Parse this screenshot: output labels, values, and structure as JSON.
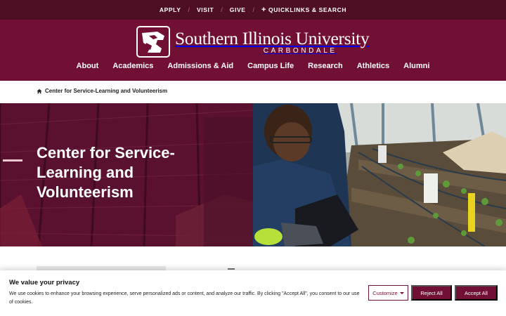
{
  "utility_nav": {
    "items": [
      "APPLY",
      "VISIT",
      "GIVE"
    ],
    "quicklinks_label": "QUICKLINKS & SEARCH"
  },
  "logo": {
    "name": "Southern Illinois University",
    "campus": "CARBONDALE"
  },
  "main_nav": [
    "About",
    "Academics",
    "Admissions & Aid",
    "Campus Life",
    "Research",
    "Athletics",
    "Alumni"
  ],
  "breadcrumb": {
    "icon": "home-icon",
    "current": "Center for Service-Learning and Volunteerism"
  },
  "hero": {
    "title": "Center for Service-Learning and Volunteerism",
    "image_description_icon": "garden-photo"
  },
  "cookie_banner": {
    "title": "We value your privacy",
    "text": "We use cookies to enhance your browsing experience, serve personalized ads or content, and analyze our traffic. By clicking \"Accept All\", you consent to our use of cookies.",
    "customize_label": "Customize",
    "reject_label": "Reject All",
    "accept_label": "Accept All"
  },
  "colors": {
    "maroon": "#720f35",
    "dark_maroon": "#4e0e24"
  }
}
